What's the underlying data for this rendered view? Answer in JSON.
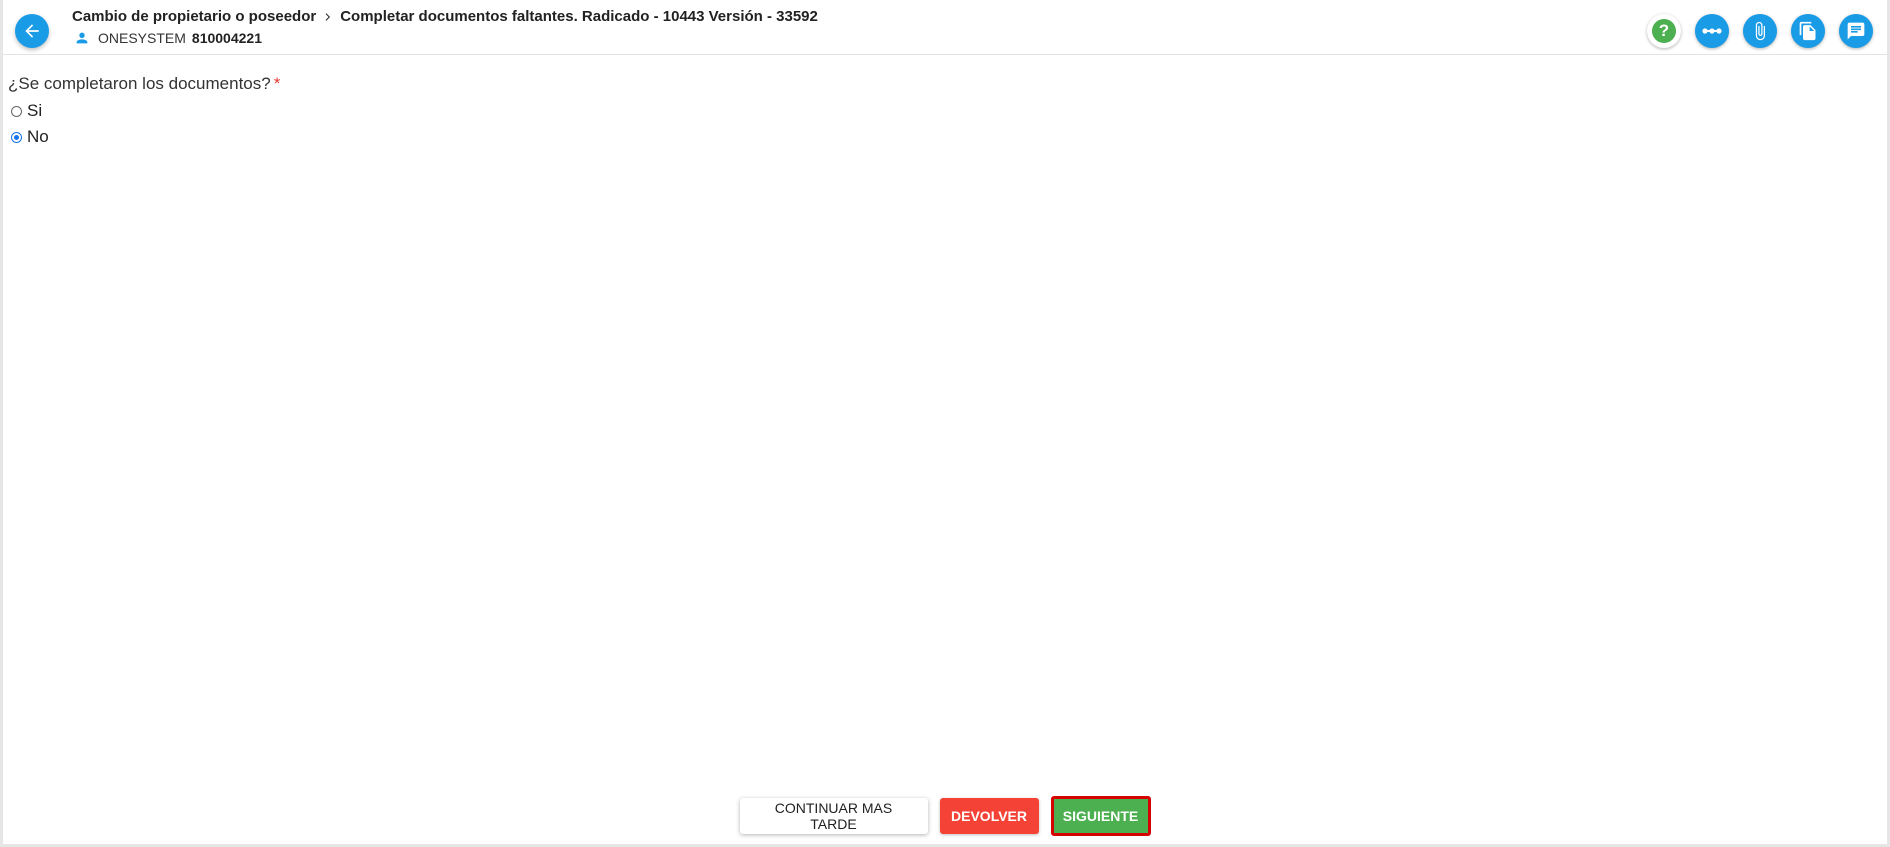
{
  "header": {
    "breadcrumb": {
      "process": "Cambio de propietario o poseedor",
      "task": "Completar documentos faltantes. Radicado - 10443 Versión - 33592"
    },
    "user": {
      "name": "ONESYSTEM",
      "id": "810004221"
    },
    "accent_color": "#1a9be6",
    "icons": [
      "arrow-left-icon",
      "chevron-right-icon",
      "person-icon",
      "help-icon",
      "flow-icon",
      "paperclip-icon",
      "documents-icon",
      "comments-icon"
    ]
  },
  "form": {
    "question": "¿Se completaron los documentos?",
    "required_mark": "*",
    "options": [
      {
        "label": "Si",
        "checked": false
      },
      {
        "label": "No",
        "checked": true
      }
    ]
  },
  "footer": {
    "continue_later_label": "CONTINUAR MAS TARDE",
    "return_label": "DEVOLVER",
    "next_label": "SIGUIENTE",
    "return_color": "#f44336",
    "next_color": "#4caf50",
    "highlight_color": "#d50000"
  }
}
